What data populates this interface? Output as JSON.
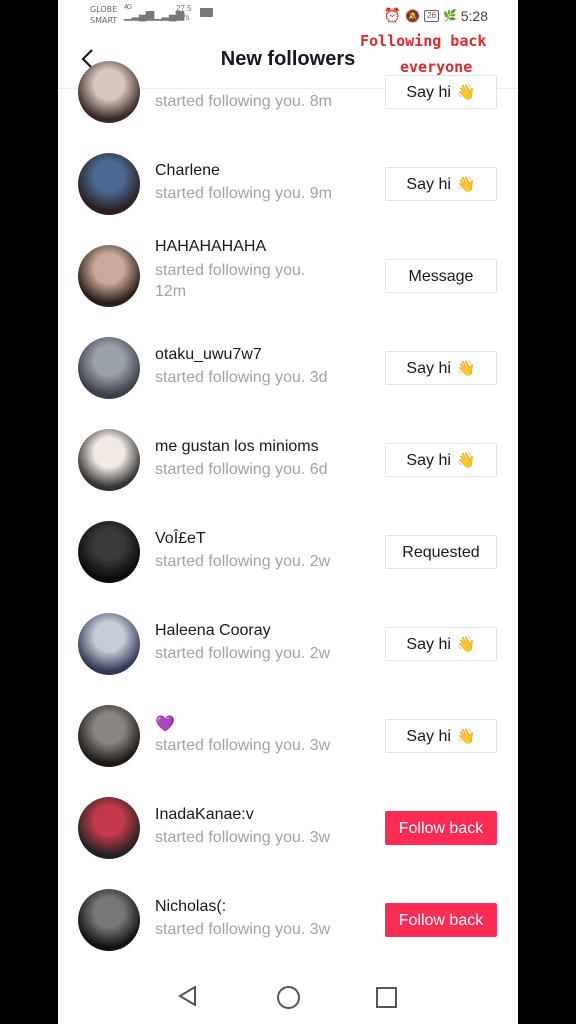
{
  "status": {
    "carrier_top": "GLOBE",
    "carrier_bottom": "SMART",
    "network_tag": "4G",
    "speed_value": "27.5",
    "speed_unit": "K/s",
    "battery": "26",
    "time": "5:28"
  },
  "header": {
    "title": "New followers"
  },
  "overlay": {
    "line1": "Following back",
    "line2": "everyone"
  },
  "followers": [
    {
      "name": "",
      "sub": "started following you. 8m",
      "button": "Say hi",
      "wave": true,
      "style": "outline",
      "avatar_colors": [
        "#d9c6bd",
        "#3a2a26"
      ]
    },
    {
      "name": "Charlene",
      "sub": "started following you. 9m",
      "button": "Say hi",
      "wave": true,
      "style": "outline",
      "avatar_colors": [
        "#4a6a93",
        "#2a2020"
      ]
    },
    {
      "name": "HAHAHAHAHA",
      "sub": "started following you. 12m",
      "button": "Message",
      "wave": false,
      "style": "outline",
      "avatar_colors": [
        "#c9a99a",
        "#2a1c18"
      ]
    },
    {
      "name": "otaku_uwu7w7",
      "sub": "started following you. 3d",
      "button": "Say hi",
      "wave": true,
      "style": "outline",
      "avatar_colors": [
        "#9aa0a8",
        "#3b3f48"
      ]
    },
    {
      "name": "me gustan los minioms",
      "sub": "started following you. 6d",
      "button": "Say hi",
      "wave": true,
      "style": "outline",
      "avatar_colors": [
        "#f1e9e4",
        "#333333"
      ]
    },
    {
      "name": "VoÎ£eT",
      "sub": "started following you. 2w",
      "button": "Requested",
      "wave": false,
      "style": "outline",
      "avatar_colors": [
        "#3a3a3a",
        "#0a0a0a"
      ]
    },
    {
      "name": "Haleena Cooray",
      "sub": "started following you. 2w",
      "button": "Say hi",
      "wave": true,
      "style": "outline",
      "avatar_colors": [
        "#c6ccd8",
        "#303a55"
      ]
    },
    {
      "name": "💜",
      "sub": "started following you. 3w",
      "button": "Say hi",
      "wave": true,
      "style": "outline",
      "avatar_colors": [
        "#8a8580",
        "#1e1a18"
      ]
    },
    {
      "name": "InadaKanae:v",
      "sub": "started following you. 3w",
      "button": "Follow back",
      "wave": false,
      "style": "red",
      "avatar_colors": [
        "#c23a4a",
        "#222222"
      ]
    },
    {
      "name": "Nicholas(:",
      "sub": "started following you. 3w",
      "button": "Follow back",
      "wave": false,
      "style": "red",
      "avatar_colors": [
        "#777777",
        "#111111"
      ]
    }
  ],
  "wave_glyph": "👋",
  "accent": "#fe2c55",
  "overlay_color": "#e02a2a"
}
